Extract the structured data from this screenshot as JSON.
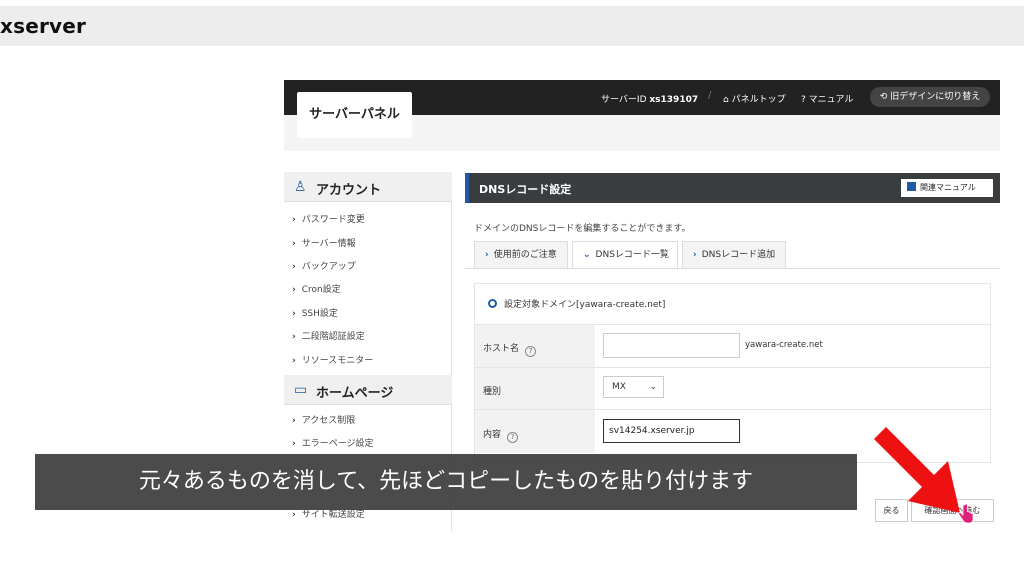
{
  "brand": "xserver",
  "panel": {
    "title": "サーバーパネル",
    "server_id_label": "サーバーID",
    "server_id": "xs139107",
    "panel_top": "パネルトップ",
    "manual": "マニュアル",
    "old_design": "旧デザインに切り替え"
  },
  "sidebar": {
    "account_heading": "アカウント",
    "account_items": [
      "パスワード変更",
      "サーバー情報",
      "バックアップ",
      "Cron設定",
      "SSH設定",
      "二段階認証設定",
      "リソースモニター"
    ],
    "homepage_heading": "ホームページ",
    "homepage_items": [
      "アクセス制限",
      "エラーページ設定",
      "サイト転送設定"
    ]
  },
  "main": {
    "title": "DNSレコード設定",
    "manual_button": "関連マニュアル",
    "description": "ドメインのDNSレコードを編集することができます。",
    "tabs": [
      {
        "label": "使用前のご注意",
        "chevron": "›"
      },
      {
        "label": "DNSレコード一覧",
        "chevron": "⌄"
      },
      {
        "label": "DNSレコード追加",
        "chevron": "›"
      }
    ],
    "target_domain": "設定対象ドメイン[yawara-create.net]",
    "form": {
      "host_label": "ホスト名",
      "host_value": "",
      "host_suffix": "yawara-create.net",
      "type_label": "種別",
      "type_value": "MX",
      "content_label": "内容",
      "content_value": "sv14254.xserver.jp"
    },
    "back_button": "戻る",
    "confirm_button": "確認画面へ進む"
  },
  "caption": "元々あるものを消して、先ほどコピーしたものを貼り付けます",
  "colors": {
    "accent": "#1f5aa6",
    "header": "#222222",
    "arrow": "#ee1111"
  }
}
